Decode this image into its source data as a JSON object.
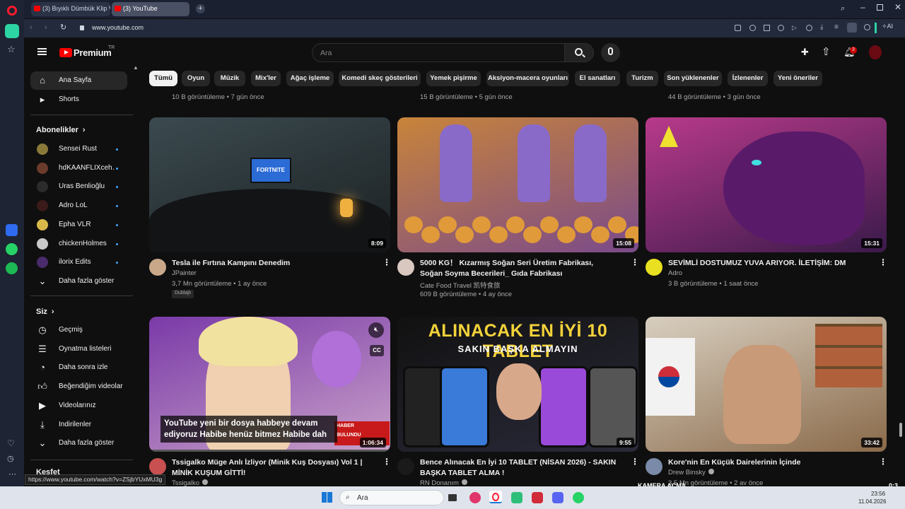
{
  "browser": {
    "tabs": [
      "(3) Bıyıklı Dümbük Klip Va",
      "(3) YouTube"
    ],
    "url": "www.youtube.com",
    "status_url": "https://www.youtube.com/watch?v=ZSjbYUxMU3g",
    "ai_label": "AI"
  },
  "header": {
    "logo": "Premium",
    "logo_sup": "TR",
    "search_placeholder": "Ara",
    "notif_count": "3"
  },
  "sidebar": {
    "main": [
      {
        "label": "Ana Sayfa",
        "icon": "home-icon"
      },
      {
        "label": "Shorts",
        "icon": "shorts-icon"
      }
    ],
    "subs_title": "Abonelikler",
    "subs": [
      {
        "label": "Sensei Rust",
        "color": "#8a7a3a"
      },
      {
        "label": "hdKAANFLIXceh…",
        "color": "#6b3b2b"
      },
      {
        "label": "Uras Benlioğlu",
        "color": "#2b2b2b"
      },
      {
        "label": "Adro LoL",
        "color": "#3a1a1a"
      },
      {
        "label": "Epha VLR",
        "color": "#d9b84a"
      },
      {
        "label": "chickenHolmes",
        "color": "#c9c9c9"
      },
      {
        "label": "ilorix Edits",
        "color": "#4a2b6b"
      }
    ],
    "subs_more": "Daha fazla göster",
    "you_title": "Siz",
    "you": [
      {
        "label": "Geçmiş",
        "icon": "history-icon"
      },
      {
        "label": "Oynatma listeleri",
        "icon": "playlist-icon"
      },
      {
        "label": "Daha sonra izle",
        "icon": "clock-icon"
      },
      {
        "label": "Beğendiğim videolar",
        "icon": "thumbs-up-icon"
      },
      {
        "label": "Videolarınız",
        "icon": "video-icon"
      },
      {
        "label": "İndirilenler",
        "icon": "download-icon"
      },
      {
        "label": "Daha fazla göster",
        "icon": "chevron-down-icon"
      }
    ],
    "explore_title": "Keşfet"
  },
  "chips": [
    "Tümü",
    "Oyun",
    "Müzik",
    "Mix'ler",
    "Ağaç işleme",
    "Komedi skeç gösterileri",
    "Yemek pişirme",
    "Aksiyon-macera oyunları",
    "El sanatları",
    "Turizm",
    "Son yüklenenler",
    "İzlenenler",
    "Yeni öneriler"
  ],
  "prev_row_meta": [
    "10 B görüntüleme • 7 gün önce",
    "15 B görüntüleme • 5 gün önce",
    "44 B görüntüleme • 3 gün önce"
  ],
  "videos": [
    {
      "title": "Tesla ile Fırtına Kampını Denedim",
      "channel": "JPainter",
      "meta": "3,7 Mn görüntüleme • 1 ay önce",
      "badge": "Dublajlı",
      "duration": "8:09",
      "screen_text": "FORTNITE",
      "color1": "#3b4a4f",
      "color2": "#1b2022",
      "avatar": "#c9a88a"
    },
    {
      "title": "5000 KG！ Kızarmış Soğan Seri Üretim Fabrikası, Soğan Soyma Becerileri_ Gıda Fabrikası",
      "channel": "Cate Food Travel 凯特食旅",
      "meta": "609 B görüntüleme • 4 ay önce",
      "duration": "15:08",
      "color1": "#c8843a",
      "color2": "#7a4a8a",
      "avatar": "#d8c8c0"
    },
    {
      "title": "SEVİMLİ DOSTUMUZ YUVA ARIYOR. İLETİŞİM: DM",
      "channel": "Adro",
      "meta": "3 B görüntüleme • 1 saat önce",
      "duration": "15:31",
      "color1": "#b83a8a",
      "color2": "#3a1a4a",
      "avatar": "#e8e020"
    },
    {
      "title": "Tssigalko Müge Anlı İzliyor (Minik Kuş Dosyası) Vol 1 | MİNİK KUŞUM GİTTİ!",
      "channel": "Tssigalko",
      "meta": "",
      "duration": "1:06:34",
      "caption": "YouTube yeni bir dosya habbeye devam ediyoruz Habibe henüz bitmez Habibe dah",
      "tv_text": "HABER",
      "tv_text2": "BULUNDU",
      "color1": "#7a3aa8",
      "color2": "#c8a0c8",
      "avatar": "#c85050"
    },
    {
      "title": "Bence Alınacak En İyi 10 TABLET (NİSAN 2026) - SAKIN BAŞKA TABLET ALMA !",
      "channel": "RN Donanım",
      "meta": "",
      "duration": "9:55",
      "headline": "ALINACAK EN İYİ 10 TABLET",
      "subline": "SAKIN BAŞKA ALMAYIN",
      "color1": "#111",
      "color2": "#2a2a3a",
      "avatar": "#1a1a1a"
    },
    {
      "title": "Kore'nin En Küçük Dairelerinin İçinde",
      "channel": "Drew Binsky",
      "meta": "3,5 Mn görüntüleme • 2 av önce",
      "duration": "33:42",
      "color1": "#d8cfc0",
      "color2": "#8a6a4a",
      "avatar": "#7a8aa8"
    }
  ],
  "overlay": {
    "camera": "KAMERA AÇMA",
    "num": "0:3"
  },
  "taskbar": {
    "search": "Ara",
    "time": "23:56",
    "date": "11.04.2026"
  },
  "colors": {
    "accent": "#ff0000",
    "chip_active_bg": "#f1f1f1",
    "verified": "#aaaaaa"
  }
}
